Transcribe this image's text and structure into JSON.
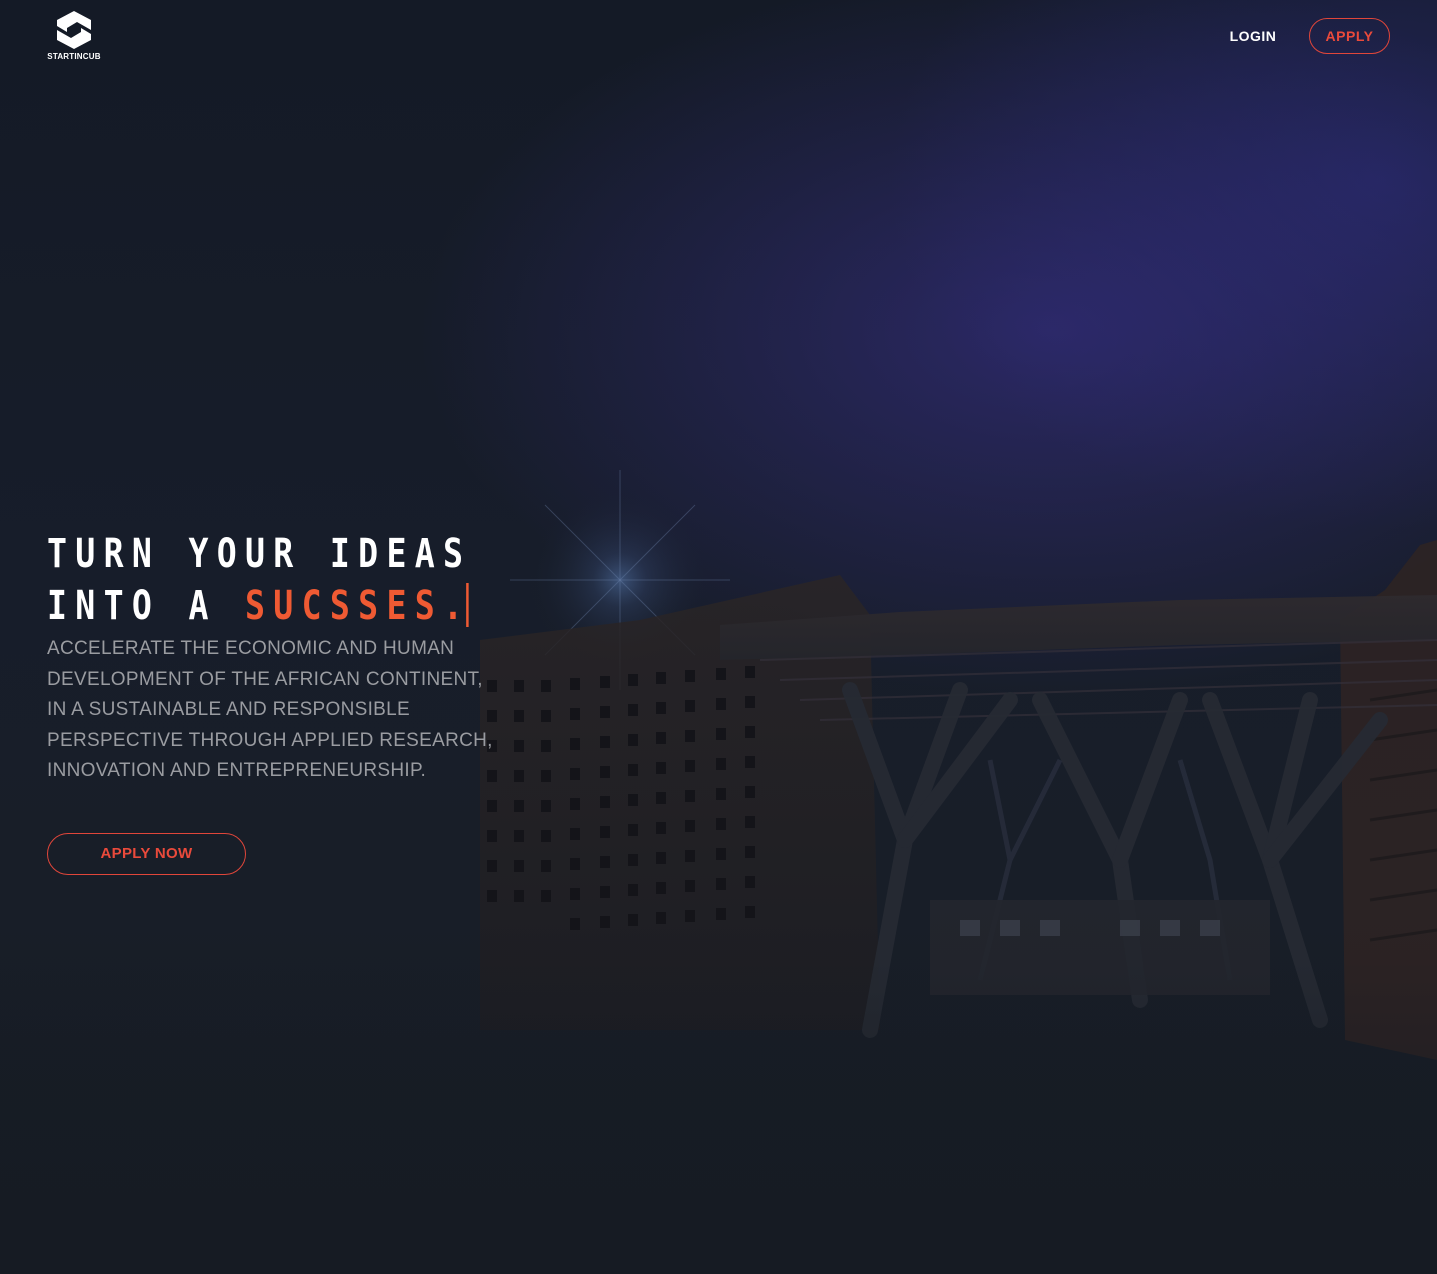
{
  "brand": {
    "name": "STARTINCUB",
    "logo_icon": "startincub-logo-icon"
  },
  "nav": {
    "login_label": "LOGIN",
    "apply_label": "APPLY"
  },
  "hero": {
    "title_line1": "TURN YOUR IDEAS",
    "title_line2_prefix": "INTO A ",
    "title_line2_accent": "SUCSSES.",
    "description": "ACCELERATE THE ECONOMIC AND HUMAN DEVELOPMENT OF THE AFRICAN CONTINENT, IN A SUSTAINABLE AND RESPONSIBLE PERSPECTIVE THROUGH APPLIED RESEARCH, INNOVATION AND ENTREPRENEURSHIP.",
    "cta_label": "APPLY NOW"
  },
  "colors": {
    "accent": "#ef5a33",
    "button_border": "#e0463a",
    "background": "#161c26",
    "text_primary": "#ffffff",
    "text_muted": "#9a9ca1"
  }
}
